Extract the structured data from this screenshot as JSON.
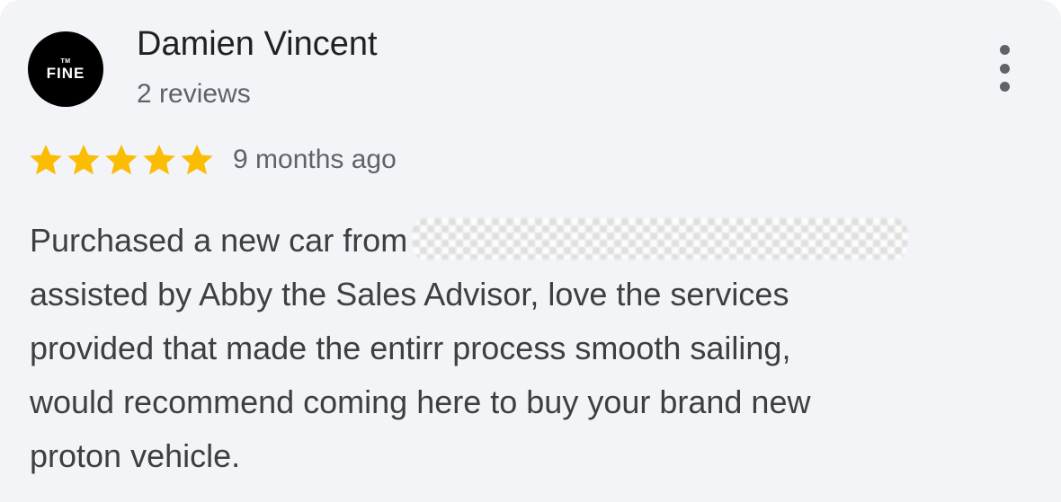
{
  "reviewer": {
    "name": "Damien Vincent",
    "review_count": "2 reviews",
    "avatar_text": "FINE",
    "avatar_mark": "TM"
  },
  "rating": {
    "stars": 5,
    "max_stars": 5,
    "star_color": "#fbbc04",
    "time_ago": "9 months ago"
  },
  "menu": {
    "icon": "more-vert-icon"
  },
  "review": {
    "line_1": "Purchased a new car from",
    "redacted_icon": "redacted-blur",
    "line_2": "assisted by Abby the Sales Advisor, love the services",
    "line_3": "provided that made the entirr process smooth sailing,",
    "line_4": "would recommend coming here to buy your brand new",
    "line_5": "proton vehicle."
  }
}
